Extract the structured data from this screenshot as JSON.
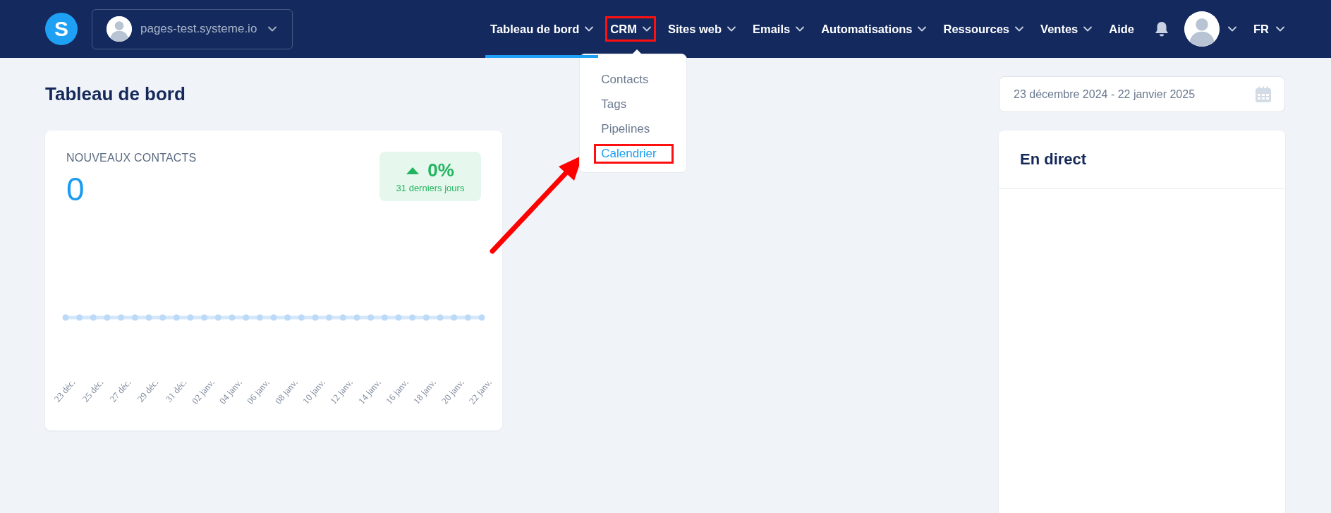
{
  "logo": {
    "letter": "S"
  },
  "site_selector": {
    "label": "pages-test.systeme.io"
  },
  "nav": [
    {
      "label": "Tableau de bord",
      "selected": true,
      "outlined": false,
      "has_caret": true
    },
    {
      "label": "CRM",
      "selected": false,
      "outlined": true,
      "has_caret": true,
      "menu": [
        {
          "label": "Contacts",
          "selected": false,
          "outlined": false
        },
        {
          "label": "Tags",
          "selected": false,
          "outlined": false
        },
        {
          "label": "Pipelines",
          "selected": false,
          "outlined": false
        },
        {
          "label": "Calendrier",
          "selected": true,
          "outlined": true
        }
      ]
    },
    {
      "label": "Sites web",
      "selected": false,
      "outlined": false,
      "has_caret": true
    },
    {
      "label": "Emails",
      "selected": false,
      "outlined": false,
      "has_caret": true
    },
    {
      "label": "Automatisations",
      "selected": false,
      "outlined": false,
      "has_caret": true
    },
    {
      "label": "Ressources",
      "selected": false,
      "outlined": false,
      "has_caret": true
    },
    {
      "label": "Ventes",
      "selected": false,
      "outlined": false,
      "has_caret": true
    },
    {
      "label": "Aide",
      "selected": false,
      "outlined": false,
      "has_caret": false
    }
  ],
  "language": "FR",
  "page_title": "Tableau de bord",
  "date_range": "23 décembre 2024 - 22 janvier 2025",
  "new_contacts": {
    "title": "NOUVEAUX CONTACTS",
    "count": "0",
    "change": {
      "value": "0%",
      "period": "31 derniers jours"
    },
    "x_labels": [
      "23 déc.",
      "25 déc.",
      "27 déc.",
      "29 déc.",
      "31 déc.",
      "02 janv.",
      "04 janv.",
      "06 janv.",
      "08 janv.",
      "10 janv.",
      "12 janv.",
      "14 janv.",
      "16 janv.",
      "18 janv.",
      "20 janv.",
      "22 janv."
    ]
  },
  "live": {
    "title": "En direct"
  }
}
